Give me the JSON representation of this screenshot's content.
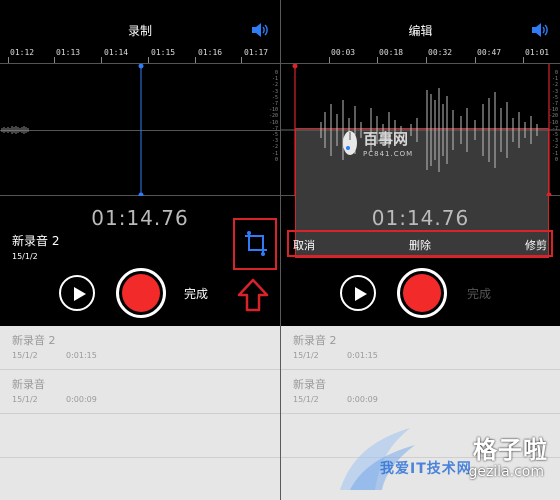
{
  "left_panel": {
    "title": "录制",
    "ruler_labels": [
      "01:12",
      "01:13",
      "01:14",
      "01:15",
      "01:16",
      "01:17"
    ],
    "db_scale": [
      "0",
      "-1",
      "-2",
      "-3",
      "-5",
      "-7",
      "-10",
      "-20",
      "-10",
      "-7",
      "-5",
      "-3",
      "-2",
      "-1",
      "0"
    ],
    "timer": "01:14.76",
    "recording_name": "新录音 2",
    "recording_date": "15/1/2",
    "done_label": "完成",
    "list": [
      {
        "name": "新录音 2",
        "date": "15/1/2",
        "duration": "0:01:15"
      },
      {
        "name": "新录音",
        "date": "15/1/2",
        "duration": "0:00:09"
      }
    ]
  },
  "right_panel": {
    "title": "编辑",
    "ruler_labels": [
      "00:03",
      "00:18",
      "00:32",
      "00:47",
      "01:01"
    ],
    "db_scale": [
      "0",
      "-1",
      "-2",
      "-3",
      "-5",
      "-7",
      "-10",
      "-20",
      "-10",
      "-7",
      "-5",
      "-3",
      "-2",
      "-1",
      "0"
    ],
    "timer": "01:14.76",
    "edit_actions": {
      "cancel": "取消",
      "delete": "删除",
      "trim": "修剪"
    },
    "done_label": "完成",
    "list": [
      {
        "name": "新录音 2",
        "date": "15/1/2",
        "duration": "0:01:15"
      },
      {
        "name": "新录音",
        "date": "15/1/2",
        "duration": "0:00:09"
      }
    ]
  },
  "watermarks": {
    "baishi_cn": "百事网",
    "baishi_url": "PC841.COM",
    "gezila_cn": "格子啦",
    "gezila_url": "gezila.com",
    "blue_cn": "我爱IT技术网"
  },
  "colors": {
    "accent_blue": "#2f7cf6",
    "record_red": "#f22a2a",
    "highlight_red": "#d8232a"
  }
}
